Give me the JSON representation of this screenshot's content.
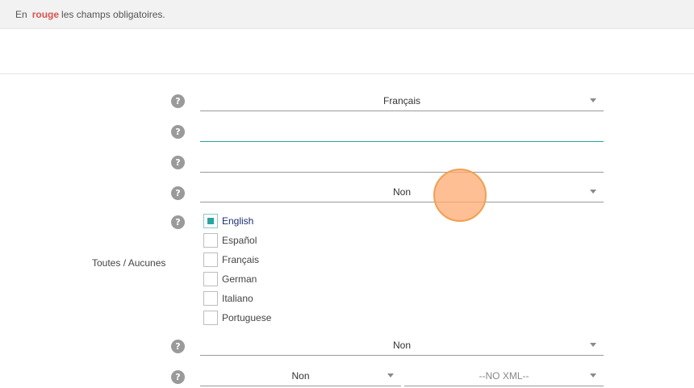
{
  "notice": {
    "prefix": "En",
    "highlight": "rouge",
    "suffix": "les champs obligatoires."
  },
  "help_icon": "?",
  "fields": {
    "language_select": {
      "value": "Français"
    },
    "text_field_1": {
      "value": ""
    },
    "text_field_2": {
      "value": ""
    },
    "yes_no_select_1": {
      "value": "Non"
    },
    "yes_no_select_2": {
      "value": "Non"
    },
    "yes_no_select_3": {
      "value": "Non"
    },
    "xml_select": {
      "value": "--NO XML--"
    }
  },
  "languages": {
    "toggle_label": "Toutes / Aucunes",
    "items": [
      {
        "label": "English",
        "checked": true
      },
      {
        "label": "Español",
        "checked": false
      },
      {
        "label": "Français",
        "checked": false
      },
      {
        "label": "German",
        "checked": false
      },
      {
        "label": "Italiano",
        "checked": false
      },
      {
        "label": "Portuguese",
        "checked": false
      }
    ]
  },
  "colors": {
    "required": "#d9534f",
    "accent": "#2aa3a3",
    "help_icon_bg": "#9a9a9a",
    "cursor": "#fda972"
  }
}
